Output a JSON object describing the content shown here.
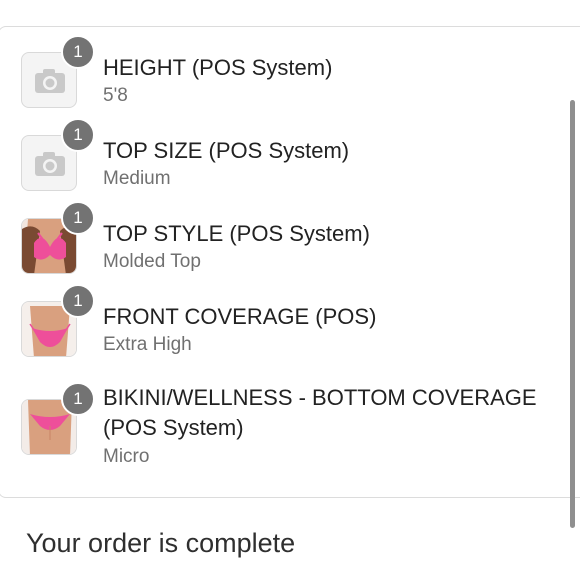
{
  "items": [
    {
      "name": "HEIGHT (POS System)",
      "value": "5'8",
      "quantity": "1",
      "image": "camera-placeholder-icon"
    },
    {
      "name": "TOP SIZE (POS System)",
      "value": "Medium",
      "quantity": "1",
      "image": "camera-placeholder-icon"
    },
    {
      "name": "TOP STYLE (POS System)",
      "value": "Molded Top",
      "quantity": "1",
      "image": "pink-bikini-top-photo"
    },
    {
      "name": "FRONT COVERAGE (POS)",
      "value": "Extra High",
      "quantity": "1",
      "image": "pink-bikini-bottom-front-photo"
    },
    {
      "name_line1": "BIKINI/WELLNESS - BOTTOM COVERAGE",
      "name_line2": "(POS System)",
      "value": "Micro",
      "quantity": "1",
      "image": "pink-bikini-bottom-back-photo"
    }
  ],
  "status": {
    "order_complete": "Your order is complete"
  },
  "colors": {
    "badge": "#737373",
    "swimsuit_pink": "#ee4f9a",
    "skin": "#d9a07f",
    "placeholder": "#f4f4f4"
  }
}
